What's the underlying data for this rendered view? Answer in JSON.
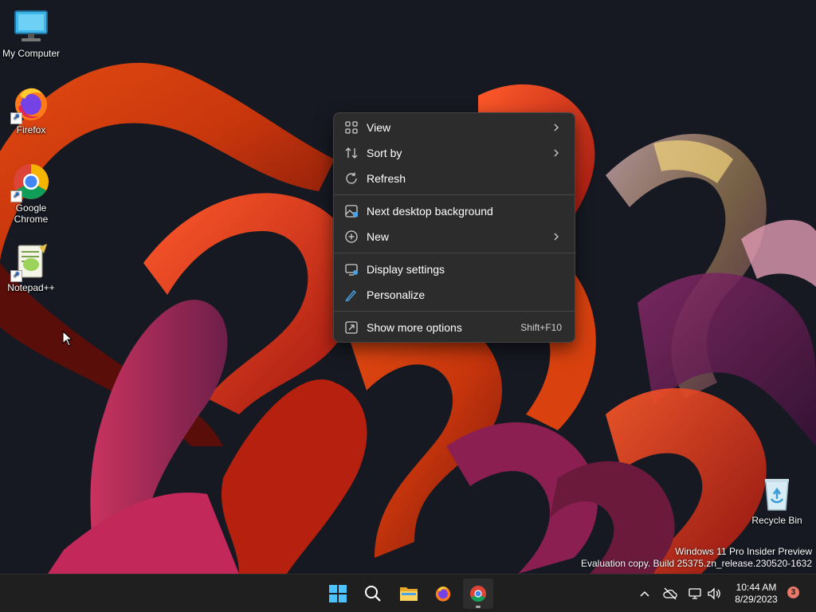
{
  "desktop": {
    "icons": [
      {
        "label": "My Computer",
        "icon": "monitor-icon"
      },
      {
        "label": "Firefox",
        "icon": "firefox-icon"
      },
      {
        "label": "Google Chrome",
        "icon": "chrome-icon"
      },
      {
        "label": "Notepad++",
        "icon": "notepadpp-icon"
      },
      {
        "label": "Recycle Bin",
        "icon": "recycle-bin-icon"
      }
    ]
  },
  "context_menu": {
    "items": [
      {
        "label": "View",
        "icon": "grid-icon",
        "submenu": true
      },
      {
        "label": "Sort by",
        "icon": "sort-icon",
        "submenu": true
      },
      {
        "label": "Refresh",
        "icon": "refresh-icon",
        "submenu": false
      },
      {
        "label": "Next desktop background",
        "icon": "image-icon",
        "submenu": false
      },
      {
        "label": "New",
        "icon": "plus-circle-icon",
        "submenu": true
      },
      {
        "label": "Display settings",
        "icon": "display-icon",
        "submenu": false
      },
      {
        "label": "Personalize",
        "icon": "pen-icon",
        "submenu": false
      },
      {
        "label": "Show more options",
        "icon": "more-options-icon",
        "submenu": false,
        "shortcut": "Shift+F10"
      }
    ]
  },
  "watermark": {
    "line1": "Windows 11 Pro Insider Preview",
    "line2": "Evaluation copy. Build 25375.zn_release.230520-1632"
  },
  "taskbar": {
    "apps": [
      "start-icon",
      "search-icon",
      "file-explorer-icon",
      "firefox-icon",
      "chrome-icon"
    ],
    "active_app": "chrome-icon",
    "tray": [
      "chevron-up-icon",
      "cloud-off-icon",
      "network-icon",
      "volume-icon"
    ],
    "clock": {
      "time": "10:44 AM",
      "date": "8/29/2023"
    },
    "notification_count": "3"
  },
  "colors": {
    "taskbar": "#1f1f1f",
    "menu": "#2c2c2c",
    "accent": "#0078d4"
  }
}
